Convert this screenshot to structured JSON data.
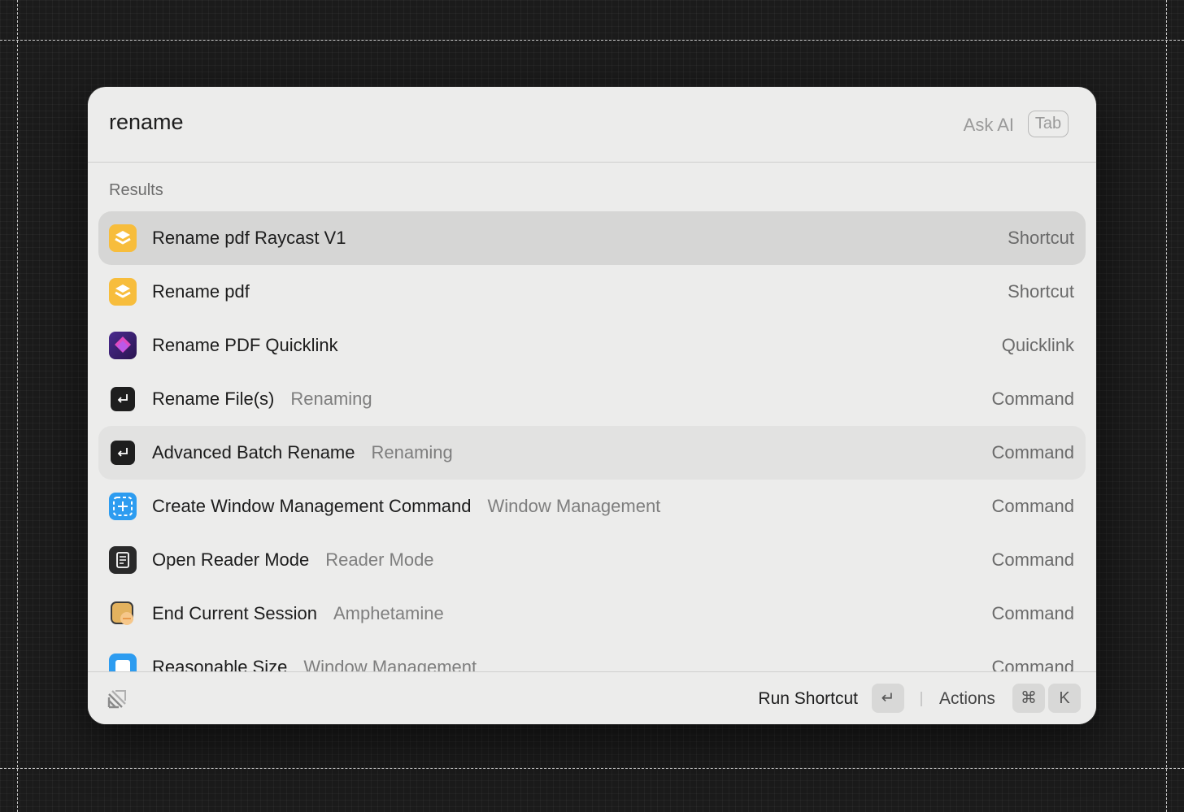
{
  "search": {
    "query": "rename",
    "ask_ai_label": "Ask AI",
    "tab_key": "Tab"
  },
  "results": {
    "section_label": "Results",
    "items": [
      {
        "title": "Rename pdf Raycast V1",
        "subtitle": "",
        "type": "Shortcut",
        "icon": "shortcuts-app-icon",
        "state": "selected"
      },
      {
        "title": "Rename pdf",
        "subtitle": "",
        "type": "Shortcut",
        "icon": "shortcuts-app-icon",
        "state": ""
      },
      {
        "title": "Rename PDF Quicklink",
        "subtitle": "",
        "type": "Quicklink",
        "icon": "quicklink-icon",
        "state": ""
      },
      {
        "title": "Rename File(s)",
        "subtitle": "Renaming",
        "type": "Command",
        "icon": "return-command-icon",
        "state": ""
      },
      {
        "title": "Advanced Batch Rename",
        "subtitle": "Renaming",
        "type": "Command",
        "icon": "return-command-icon",
        "state": "hovered"
      },
      {
        "title": "Create Window Management Command",
        "subtitle": "Window Management",
        "type": "Command",
        "icon": "window-add-icon",
        "state": ""
      },
      {
        "title": "Open Reader Mode",
        "subtitle": "Reader Mode",
        "type": "Command",
        "icon": "reader-mode-icon",
        "state": ""
      },
      {
        "title": "End Current Session",
        "subtitle": "Amphetamine",
        "type": "Command",
        "icon": "amphetamine-icon",
        "state": ""
      },
      {
        "title": "Reasonable Size",
        "subtitle": "Window Management",
        "type": "Command",
        "icon": "window-size-icon",
        "state": ""
      }
    ]
  },
  "footer": {
    "logo_icon": "raycast-logo-icon",
    "primary_action_label": "Run Shortcut",
    "primary_action_key": "↵",
    "actions_label": "Actions",
    "actions_keys": [
      "⌘",
      "K"
    ]
  },
  "colors": {
    "window_bg": "#ececeb",
    "selected_row": "#d6d6d5",
    "hovered_row": "#e2e2e1",
    "shortcut_icon": "#f7bd3c",
    "quicklink_icon": "#7b3fb6",
    "window_icon": "#2d9cf0"
  }
}
